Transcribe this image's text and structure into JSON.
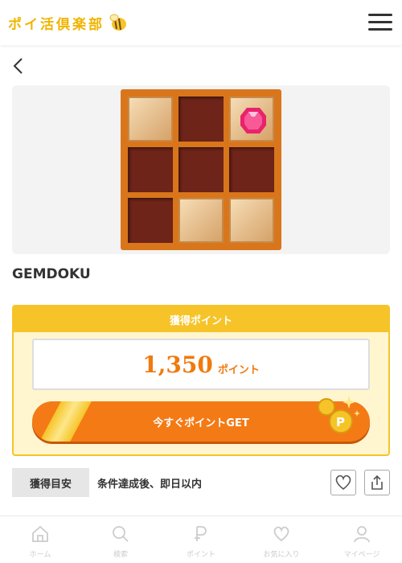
{
  "header": {
    "logo_text": "ポイ活倶楽部"
  },
  "offer": {
    "title": "GEMDOKU",
    "points_heading": "獲得ポイント",
    "points_value": "1,350",
    "points_unit": "ポイント",
    "get_button_label": "今すぐポイントGET",
    "timing_tag": "獲得目安",
    "timing_text": "条件達成後、即日以内"
  },
  "tabbar": {
    "items": [
      {
        "label": "ホーム",
        "icon": "home-icon"
      },
      {
        "label": "検索",
        "icon": "search-icon"
      },
      {
        "label": "ポイント",
        "icon": "point-icon"
      },
      {
        "label": "お気に入り",
        "icon": "heart-icon"
      },
      {
        "label": "マイページ",
        "icon": "user-icon"
      }
    ]
  },
  "colors": {
    "accent_yellow": "#f6c428",
    "accent_orange": "#f47a16",
    "points_text": "#f07a0d"
  }
}
